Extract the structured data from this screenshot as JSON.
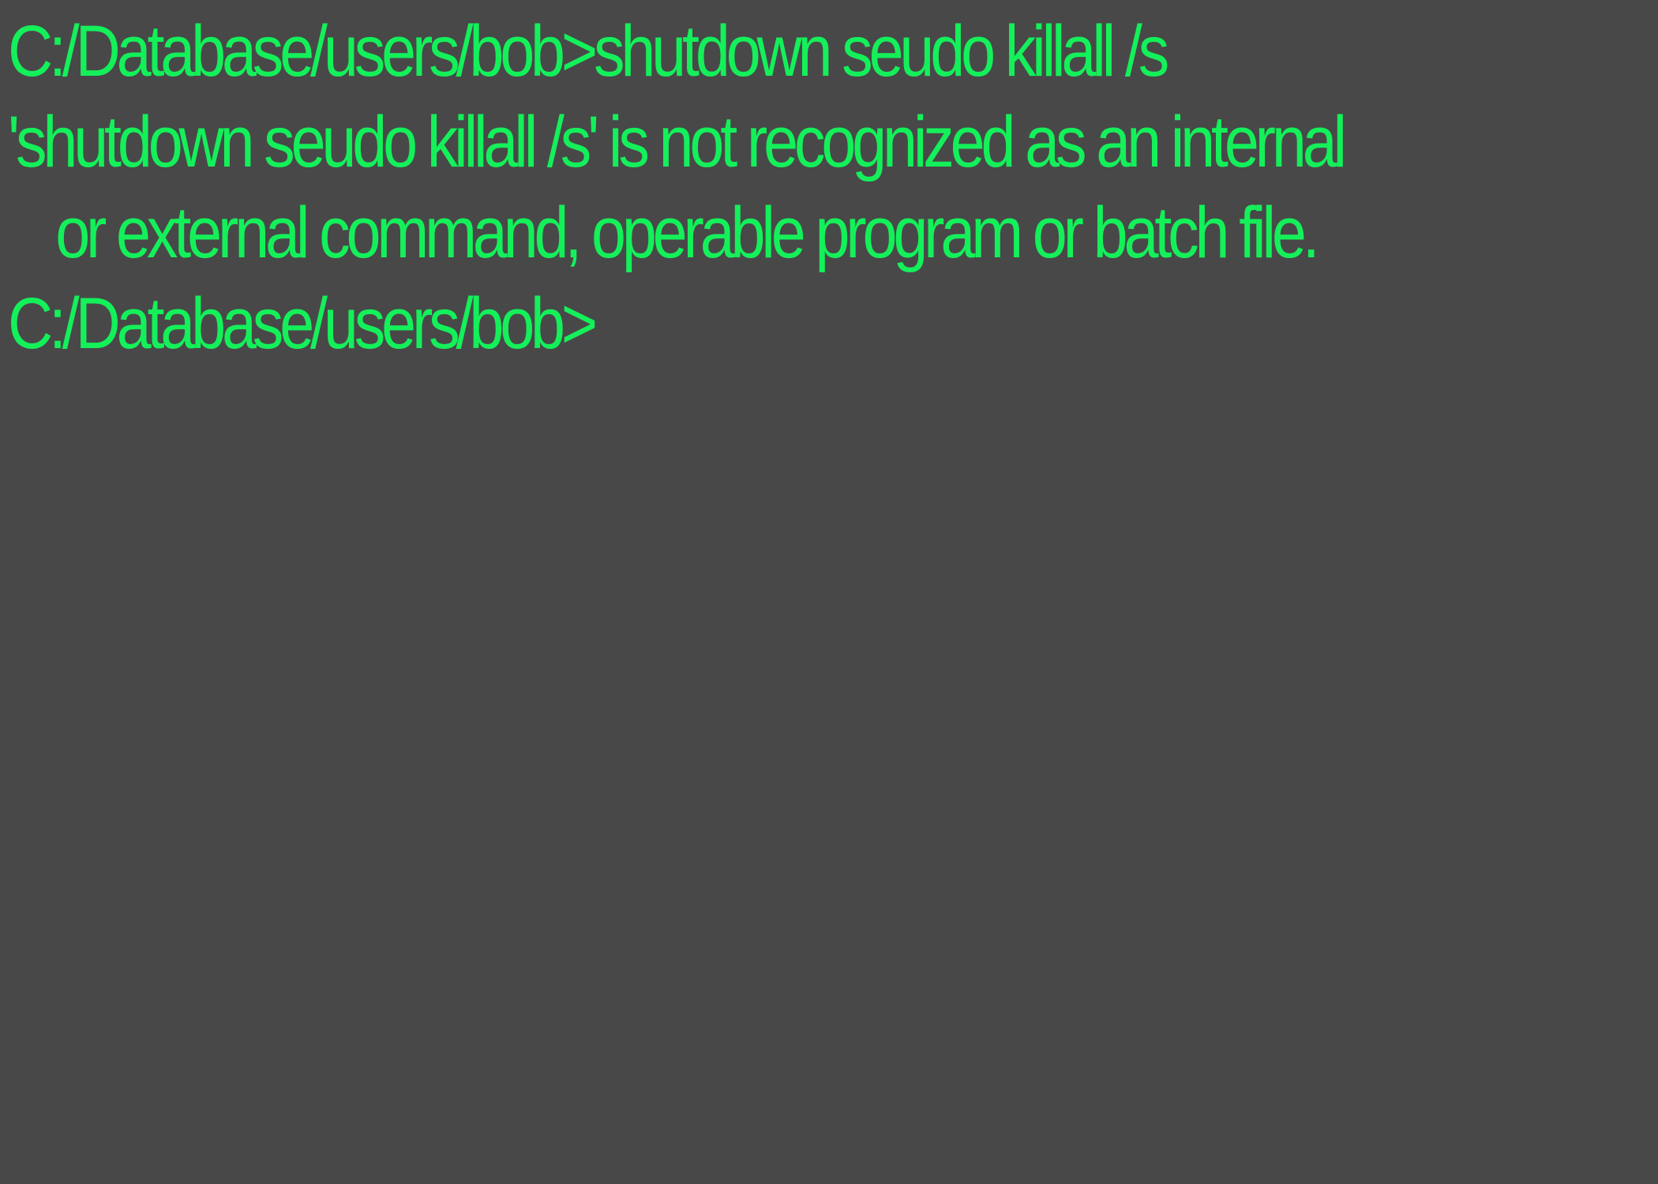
{
  "terminal": {
    "prompt": "C:/Database/users/bob>",
    "lines": [
      {
        "prompt": "C:/Database/users/bob>",
        "command": "shutdown seudo killall /s"
      },
      {
        "text": "'shutdown seudo killall /s' is not recognized as an internal"
      },
      {
        "text": "or external command, operable program or batch file."
      },
      {
        "prompt": "C:/Database/users/bob>",
        "command": ""
      }
    ]
  },
  "colors": {
    "background": "#484848",
    "text": "#14f05a"
  }
}
